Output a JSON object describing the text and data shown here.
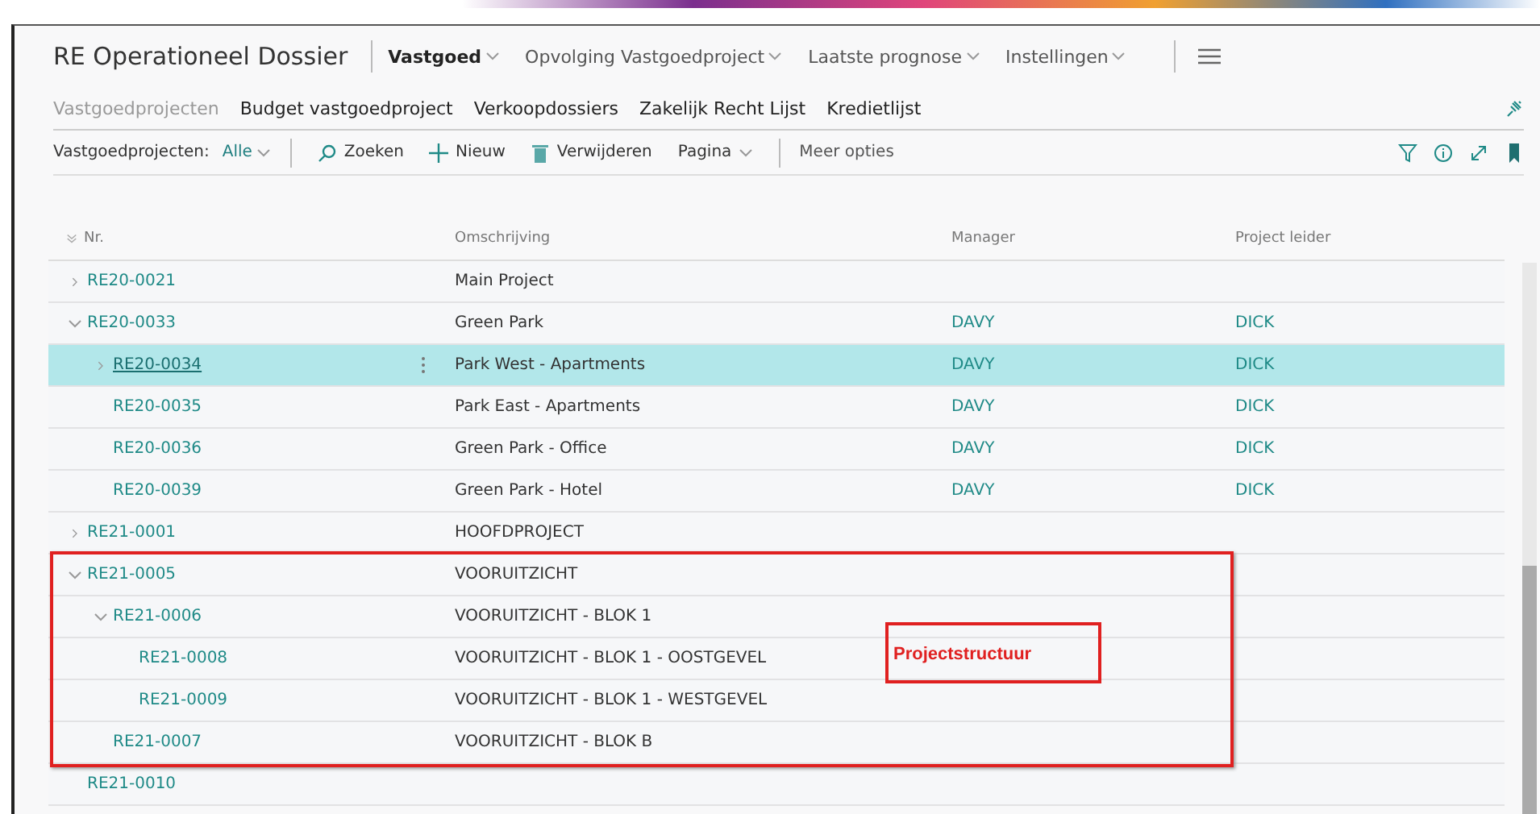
{
  "app_title": "RE Operationeel Dossier",
  "nav_menus": [
    {
      "label": "Vastgoed",
      "selected": true
    },
    {
      "label": "Opvolging Vastgoedproject",
      "selected": false
    },
    {
      "label": "Laatste prognose",
      "selected": false
    },
    {
      "label": "Instellingen",
      "selected": false
    }
  ],
  "nav_links": [
    {
      "label": "Vastgoedprojecten",
      "disabled": true
    },
    {
      "label": "Budget vastgoedproject",
      "disabled": false
    },
    {
      "label": "Verkoopdossiers",
      "disabled": false
    },
    {
      "label": "Zakelijk Recht Lijst",
      "disabled": false
    },
    {
      "label": "Kredietlijst",
      "disabled": false
    }
  ],
  "toolbar": {
    "list_label": "Vastgoedprojecten:",
    "filter": "Alle",
    "actions": [
      {
        "label": "Zoeken",
        "kind": "search"
      },
      {
        "label": "Nieuw",
        "kind": "plus"
      },
      {
        "label": "Verwijderen",
        "kind": "trash"
      },
      {
        "label": "Pagina",
        "kind": "dropdown"
      }
    ],
    "more": "Meer opties"
  },
  "table": {
    "columns": [
      "Nr.",
      "Omschrijving",
      "Manager",
      "Project leider"
    ],
    "rows": [
      {
        "nr": "RE20-0021",
        "description": "Main Project",
        "expanded": false,
        "selected": false
      },
      {
        "nr": "RE20-0033",
        "description": "Green Park",
        "manager": "DAVY",
        "leader": "DICK",
        "expanded": true,
        "selected": false,
        "children": [
          {
            "nr": "RE20-0034",
            "description": "Park West - Apartments",
            "manager": "DAVY",
            "leader": "DICK",
            "expanded": false,
            "selected": true
          },
          {
            "nr": "RE20-0035",
            "description": "Park East - Apartments",
            "manager": "DAVY",
            "leader": "DICK",
            "selected": false
          },
          {
            "nr": "RE20-0036",
            "description": "Green Park - Office",
            "manager": "DAVY",
            "leader": "DICK",
            "selected": false
          },
          {
            "nr": "RE20-0039",
            "description": "Green Park - Hotel",
            "manager": "DAVY",
            "leader": "DICK",
            "selected": false
          }
        ]
      },
      {
        "nr": "RE21-0001",
        "description": "HOOFDPROJECT",
        "expanded": false,
        "selected": false
      },
      {
        "nr": "RE21-0005",
        "description": "VOORUITZICHT",
        "expanded": true,
        "selected": false,
        "outlined": true,
        "children": [
          {
            "nr": "RE21-0006",
            "description": "VOORUITZICHT - BLOK 1",
            "expanded": true,
            "selected": false,
            "children": [
              {
                "nr": "RE21-0008",
                "description": "VOORUITZICHT - BLOK 1 - OOSTGEVEL",
                "selected": false
              },
              {
                "nr": "RE21-0009",
                "description": "VOORUITZICHT - BLOK 1 - WESTGEVEL",
                "selected": false
              }
            ]
          },
          {
            "nr": "RE21-0007",
            "description": "VOORUITZICHT - BLOK B",
            "selected": false
          }
        ]
      },
      {
        "nr": "RE21-0010",
        "selected": false
      }
    ]
  },
  "annotation": {
    "label": "Projectstructuur"
  }
}
